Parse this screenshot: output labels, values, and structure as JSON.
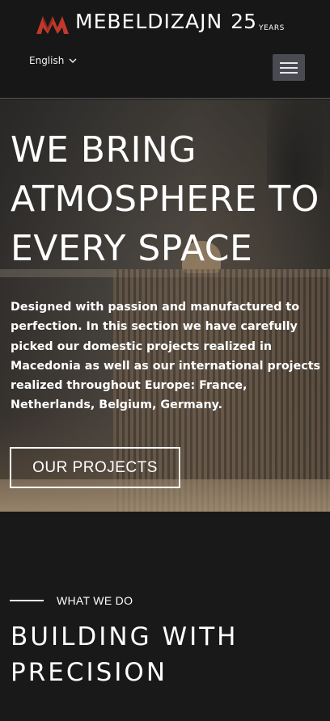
{
  "header": {
    "brand_name": "MEBELDIZAJN",
    "brand_years_number": "25",
    "brand_years_label": "YEARS",
    "logo_icon": "mebeldizajn-mark-icon",
    "language": "English",
    "menu_icon": "hamburger-menu-icon"
  },
  "hero": {
    "title": "WE BRING ATMOSPHERE TO EVERY SPACE",
    "description": "Designed with passion and manufactured to perfection. In this section we have carefully picked our domestic projects realized in Macedonia as well as our international projects realized throughout Europe: France, Netherlands, Belgium, Germany.",
    "cta_label": "OUR PROJECTS"
  },
  "section": {
    "eyebrow": "WHAT WE DO",
    "title": "BUILDING WITH PRECISION"
  },
  "colors": {
    "header_bg": "#171717",
    "page_bg": "#191919",
    "logo_accent": "#c0392b",
    "menu_button_bg": "#4a4a52",
    "text": "#ffffff"
  }
}
